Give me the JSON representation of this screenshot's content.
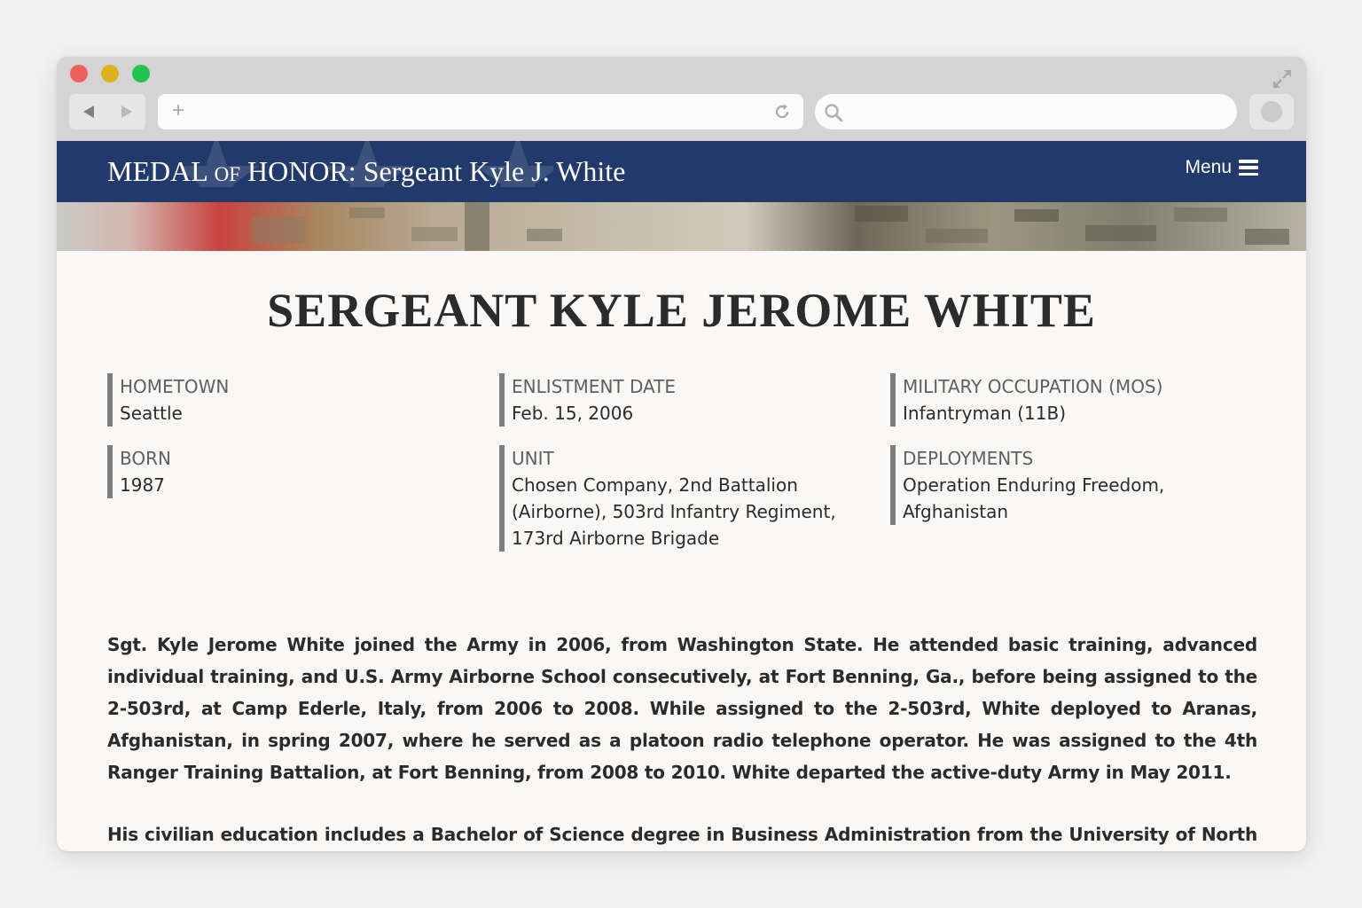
{
  "browser": {
    "address": {
      "placeholder": ""
    },
    "search": {
      "placeholder": ""
    }
  },
  "header": {
    "title_pre": "MEDAL ",
    "title_of": "OF",
    "title_post": " HONOR: Sergeant Kyle J. White",
    "menu_label": "Menu"
  },
  "page": {
    "title": "SERGEANT KYLE JEROME WHITE",
    "facts": [
      {
        "label": "HOMETOWN",
        "value": "Seattle"
      },
      {
        "label": "ENLISTMENT DATE",
        "value": "Feb. 15, 2006"
      },
      {
        "label": "MILITARY OCCUPATION (MOS)",
        "value": "Infantryman (11B)"
      },
      {
        "label": "BORN",
        "value": "1987"
      },
      {
        "label": "UNIT",
        "value": "Chosen Company, 2nd Battalion (Airborne), 503rd Infantry Regiment, 173rd Airborne Brigade"
      },
      {
        "label": "DEPLOYMENTS",
        "value": "Operation Enduring Freedom, Afghanistan"
      }
    ],
    "bio": [
      "Sgt. Kyle Jerome White joined the Army in 2006, from Washington State. He attended basic training, advanced individual training, and U.S. Army Airborne School consecutively, at Fort Benning, Ga., before being assigned to the 2-503rd, at Camp Ederle, Italy, from 2006 to 2008. While assigned to the 2-503rd, White deployed to Aranas, Afghanistan, in spring 2007, where he served as a platoon radio telephone operator. He was assigned to the 4th Ranger Training Battalion, at Fort Benning, from 2008 to 2010. White departed the active-duty Army in May 2011.",
      "His civilian education includes a Bachelor of Science degree in Business Administration from the University of North Carolina at Charlotte, where he majored in finance. He currently resides in Charlotte, where he is an investment analyst with the Royal Bank of Canada."
    ]
  },
  "colors": {
    "header_bg": "#213a6b",
    "page_bg": "#f9f8f6",
    "accent_bar": "#7d7d7d"
  },
  "icons": [
    "back-icon",
    "forward-icon",
    "plus-icon",
    "reload-icon",
    "search-icon",
    "expand-icon",
    "hamburger-icon",
    "star-icon"
  ]
}
